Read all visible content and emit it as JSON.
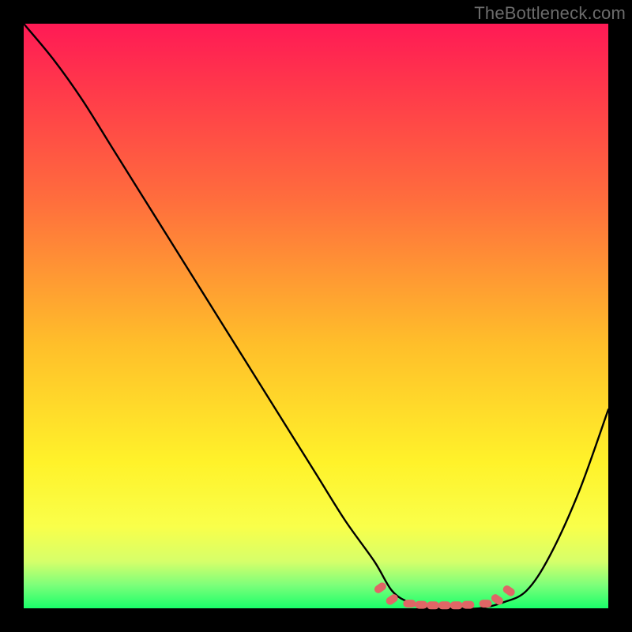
{
  "credit": "TheBottleneck.com",
  "chart_data": {
    "type": "line",
    "title": "",
    "xlabel": "",
    "ylabel": "",
    "xlim": [
      0,
      100
    ],
    "ylim": [
      0,
      100
    ],
    "note": "x is normalized horizontal position (0=left edge of plot, 100=right). y is the curve's value where 0 = bottom (green, optimal) and 100 = top (red, worst bottleneck). Values estimated from pixel positions.",
    "series": [
      {
        "name": "bottleneck-curve",
        "x": [
          0,
          5,
          10,
          15,
          20,
          25,
          30,
          35,
          40,
          45,
          50,
          55,
          60,
          63,
          66,
          70,
          74,
          78,
          82,
          86,
          90,
          95,
          100
        ],
        "y": [
          100,
          94,
          87,
          79,
          71,
          63,
          55,
          47,
          39,
          31,
          23,
          15,
          8,
          3,
          1,
          0,
          0,
          0,
          1,
          3,
          9,
          20,
          34
        ]
      }
    ],
    "markers": {
      "name": "highlight-dots",
      "comment": "coral dots along the valley floor",
      "x": [
        61,
        63,
        66,
        68,
        70,
        72,
        74,
        76,
        79,
        81,
        83
      ],
      "y": [
        3.5,
        1.5,
        0.8,
        0.6,
        0.5,
        0.5,
        0.5,
        0.6,
        0.8,
        1.5,
        3.0
      ]
    },
    "colors": {
      "curve": "#000000",
      "markers": "#e06666",
      "gradient_top": "#ff1a55",
      "gradient_mid": "#fff22a",
      "gradient_bottom": "#1aff6a",
      "frame": "#000000",
      "credit_text": "#6b6b6b"
    }
  }
}
